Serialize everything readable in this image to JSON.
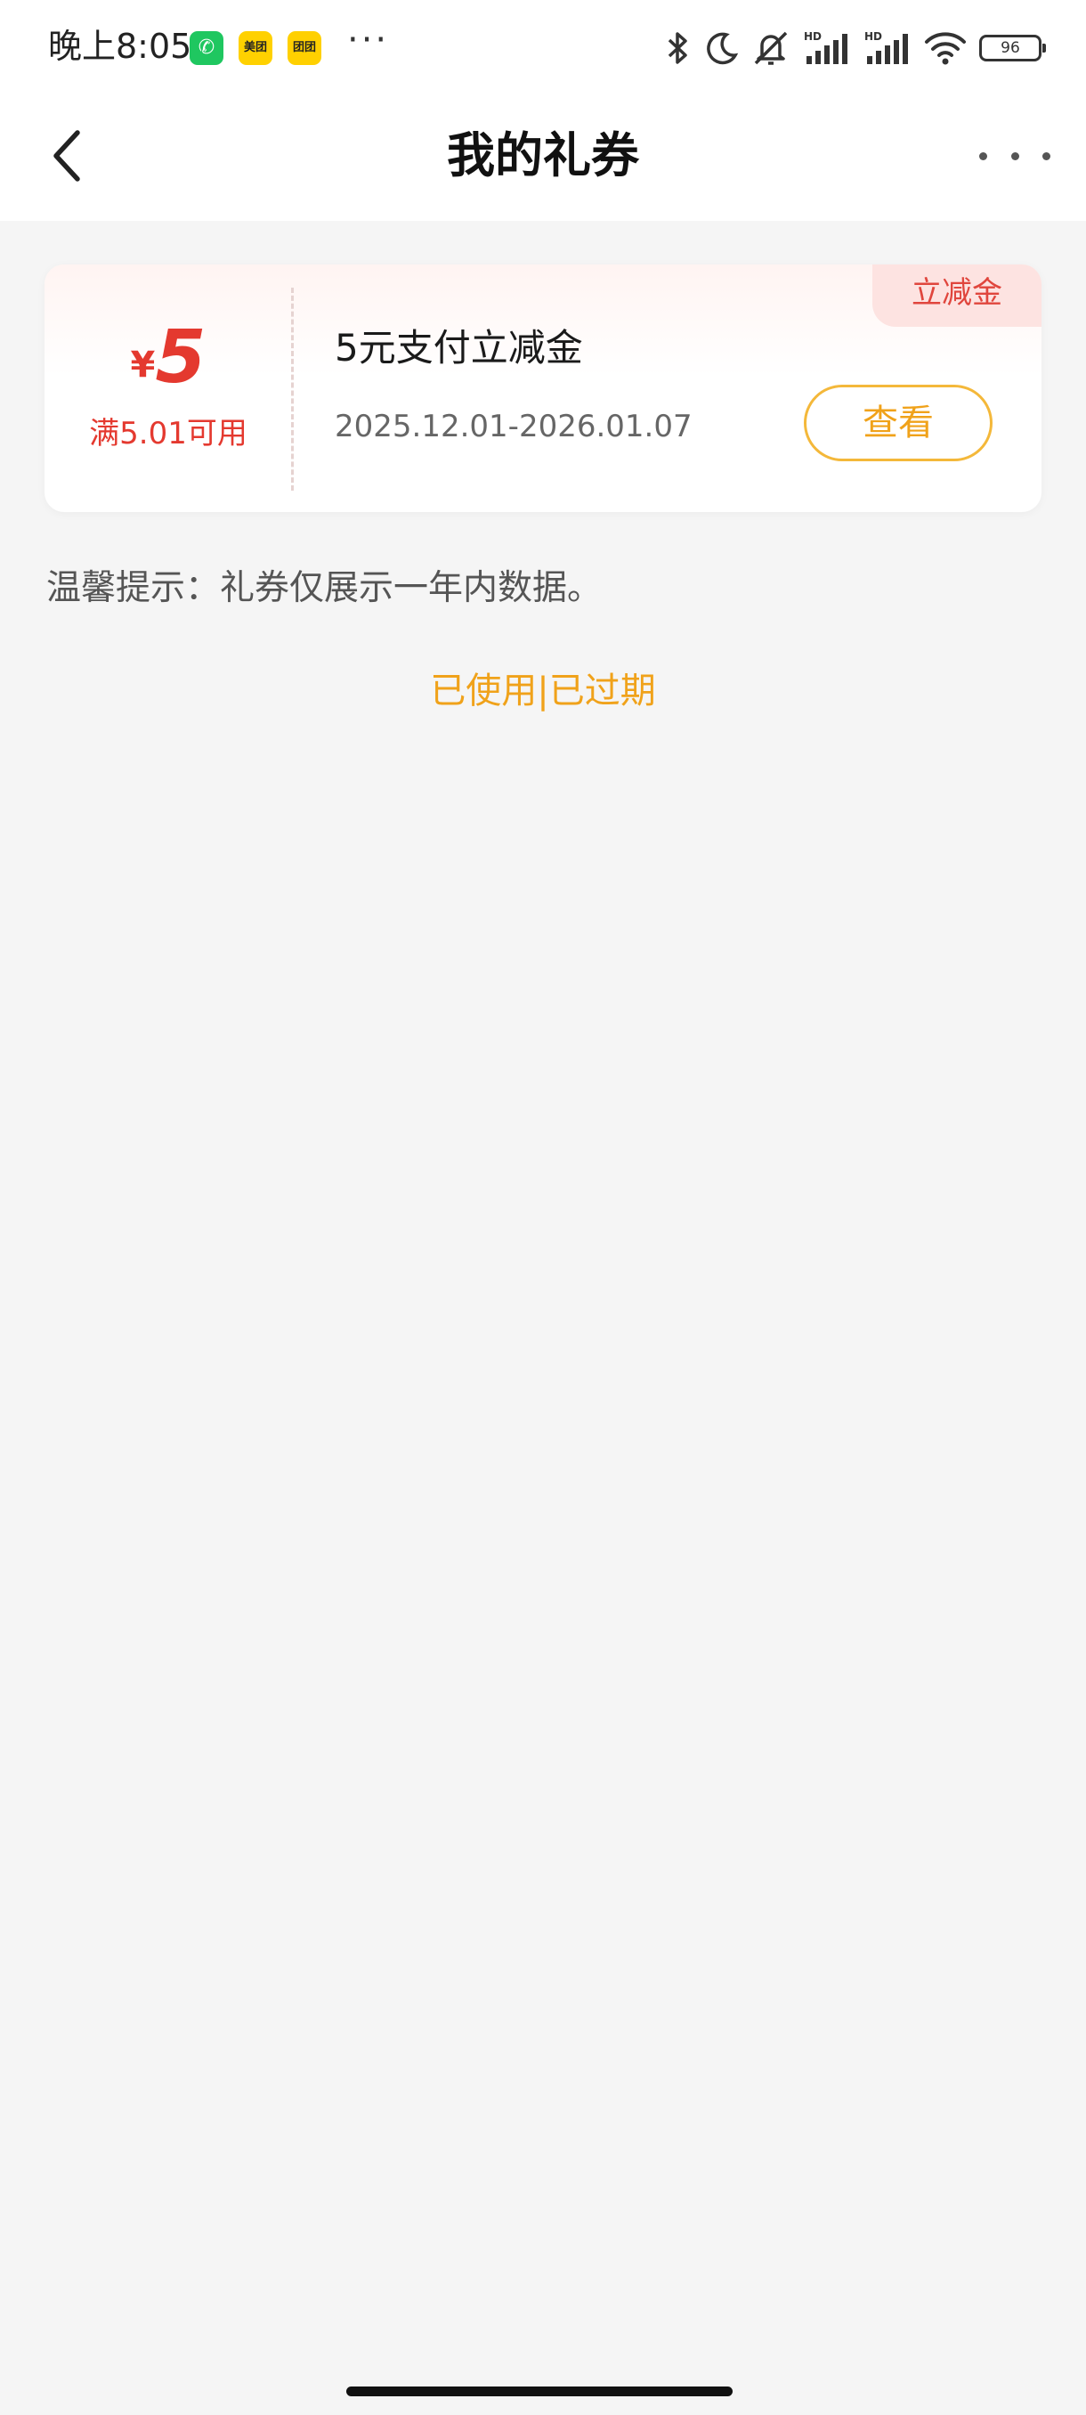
{
  "status_bar": {
    "time": "晚上8:05",
    "wechat_icon_glyph": "✆",
    "meituan_label": "美团",
    "tuanhao_label": "团团",
    "more_dots": "···",
    "battery_level": "96"
  },
  "nav": {
    "title": "我的礼券"
  },
  "coupon": {
    "tag": "立减金",
    "currency": "¥",
    "amount": "5",
    "condition": "满5.01可用",
    "name": "5元支付立减金",
    "validity": "2025.12.01-2026.01.07",
    "view_label": "查看"
  },
  "tip": "温馨提示：礼券仅展示一年内数据。",
  "history_link": "已使用|已过期",
  "colors": {
    "accent_orange": "#f0a21a",
    "coupon_red": "#e4392f",
    "background": "#f5f5f5"
  }
}
